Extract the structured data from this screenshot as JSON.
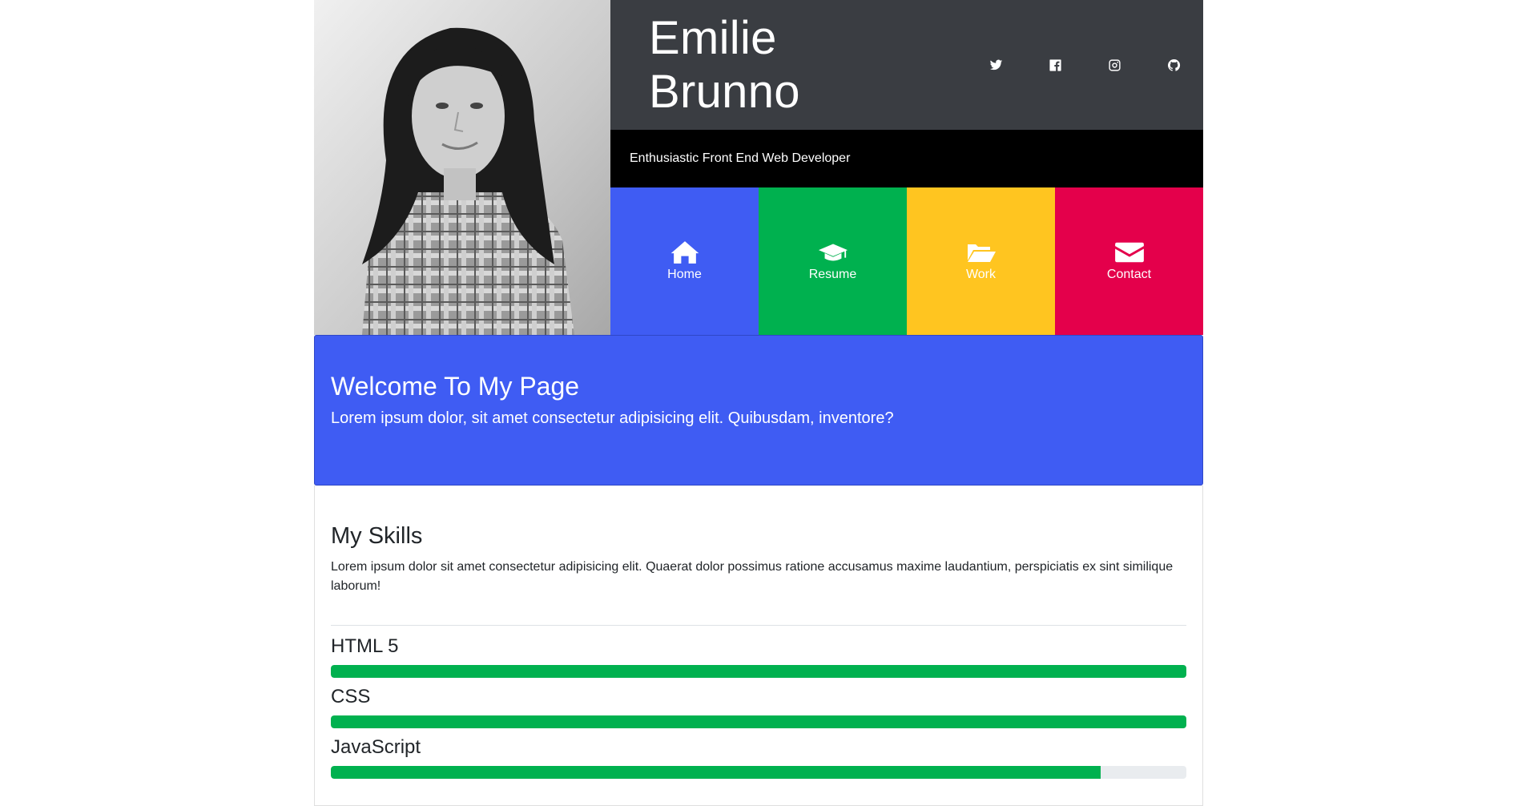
{
  "header": {
    "name": "Emilie Brunno",
    "tagline": "Enthusiastic Front End Web Developer",
    "social": [
      {
        "icon": "twitter-icon"
      },
      {
        "icon": "facebook-icon"
      },
      {
        "icon": "instagram-icon"
      },
      {
        "icon": "github-icon"
      }
    ]
  },
  "nav": {
    "items": [
      {
        "label": "Home",
        "icon": "home-icon",
        "color": "#3f5cf3"
      },
      {
        "label": "Resume",
        "icon": "graduation-cap-icon",
        "color": "#00b14f"
      },
      {
        "label": "Work",
        "icon": "folder-open-icon",
        "color": "#ffc520"
      },
      {
        "label": "Contact",
        "icon": "envelope-icon",
        "color": "#e4004b"
      }
    ]
  },
  "welcome": {
    "title": "Welcome To My Page",
    "text": "Lorem ipsum dolor, sit amet consectetur adipisicing elit. Quibusdam, inventore?"
  },
  "skills": {
    "title": "My Skills",
    "intro": "Lorem ipsum dolor sit amet consectetur adipisicing elit. Quaerat dolor possimus ratione accusamus maxime laudantium, perspiciatis ex sint similique laborum!",
    "items": [
      {
        "name": "HTML 5",
        "level": 100
      },
      {
        "name": "CSS",
        "level": 100
      },
      {
        "name": "JavaScript",
        "level": 90
      }
    ]
  },
  "colors": {
    "namebar": "#3a3d42",
    "tagbar": "#000000",
    "accent_blue": "#3f5cf3",
    "bar_fill": "#00b14f"
  }
}
